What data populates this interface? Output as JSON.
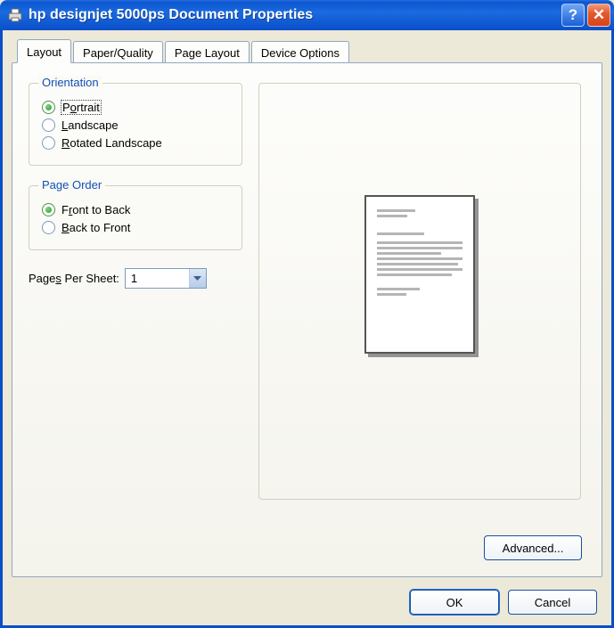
{
  "titlebar": {
    "title": "hp designjet 5000ps Document Properties",
    "help_glyph": "?",
    "close_glyph": "✕"
  },
  "tabs": {
    "layout": "Layout",
    "paper_quality": "Paper/Quality",
    "page_layout": "Page Layout",
    "device_options": "Device Options"
  },
  "orientation": {
    "legend": "Orientation",
    "portrait_prefix": "P",
    "portrait_ul": "o",
    "portrait_suffix": "rtrait",
    "landscape_ul": "L",
    "landscape_suffix": "andscape",
    "rotated_ul": "R",
    "rotated_suffix": "otated Landscape",
    "selected": "portrait"
  },
  "page_order": {
    "legend": "Page Order",
    "ftb_prefix": "F",
    "ftb_ul": "r",
    "ftb_suffix": "ont to Back",
    "btf_ul": "B",
    "btf_suffix": "ack to Front",
    "selected": "front_to_back"
  },
  "pages_per_sheet": {
    "label_prefix": "Page",
    "label_ul": "s",
    "label_suffix": " Per Sheet:",
    "value": "1"
  },
  "buttons": {
    "advanced": "Advanced...",
    "ok": "OK",
    "cancel": "Cancel"
  }
}
